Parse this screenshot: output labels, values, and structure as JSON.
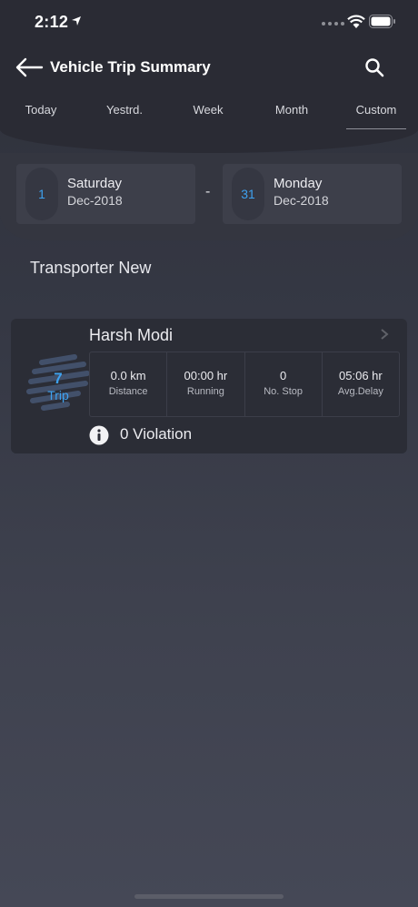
{
  "status": {
    "time": "2:12"
  },
  "nav": {
    "title": "Vehicle Trip Summary"
  },
  "tabs": [
    {
      "label": "Today"
    },
    {
      "label": "Yestrd."
    },
    {
      "label": "Week"
    },
    {
      "label": "Month"
    },
    {
      "label": "Custom",
      "active": true
    }
  ],
  "date_range": {
    "from": {
      "day_num": "1",
      "weekday": "Saturday",
      "month": "Dec-2018"
    },
    "separator": "-",
    "to": {
      "day_num": "31",
      "weekday": "Monday",
      "month": "Dec-2018"
    }
  },
  "section": {
    "title": "Transporter New"
  },
  "card": {
    "trip_count": "7",
    "trip_label": "Trip",
    "driver": "Harsh Modi",
    "stats": [
      {
        "value": "0.0 km",
        "label": "Distance"
      },
      {
        "value": "00:00 hr",
        "label": "Running"
      },
      {
        "value": "0",
        "label": "No. Stop"
      },
      {
        "value": "05:06 hr",
        "label": "Avg.Delay"
      }
    ],
    "violation": "0 Violation"
  },
  "colors": {
    "accent": "#3ea2f0",
    "background": "#353844",
    "card": "#2b2d36"
  }
}
